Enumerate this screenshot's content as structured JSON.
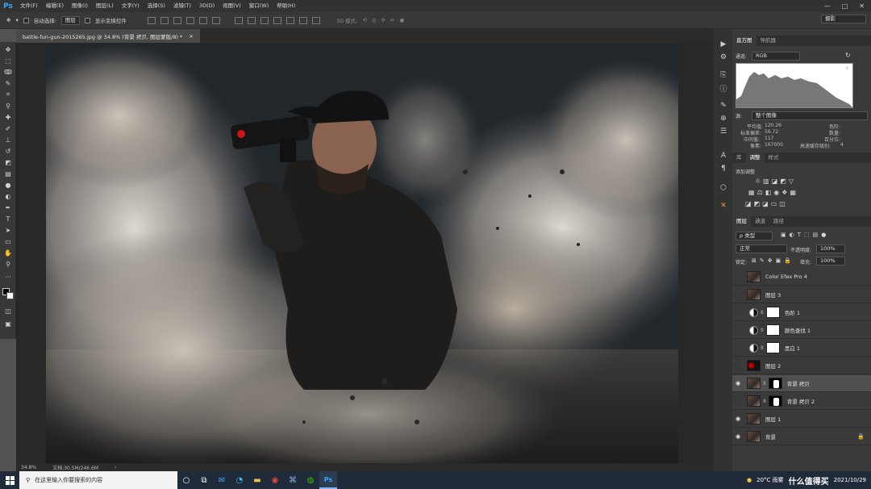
{
  "app": {
    "logo": "Ps",
    "menus": [
      "文件(F)",
      "编辑(E)",
      "图像(I)",
      "图层(L)",
      "文字(Y)",
      "选择(S)",
      "滤镜(T)",
      "3D(D)",
      "视图(V)",
      "窗口(W)",
      "帮助(H)"
    ],
    "window_controls": [
      "—",
      "□",
      "✕"
    ]
  },
  "options": {
    "auto_select_label": "自动选择:",
    "auto_select_value": "图层",
    "show_transform_label": "显示变换控件",
    "mode_3d_label": "3D 模式:",
    "workspace": "摄影"
  },
  "document": {
    "tab_title": "battle-fun-gun-2015265.jpg @ 34.8% (背景 拷贝, 图层蒙版/8) *",
    "close": "×",
    "zoom": "34.8%",
    "doc_info": "文档:30.5M/246.6M",
    "arrow": "›"
  },
  "histogram": {
    "tabs": [
      "直方图",
      "导航器"
    ],
    "channel_label": "通道:",
    "channel_value": "RGB",
    "source_label": "源:",
    "source_value": "整个图像",
    "stats": {
      "mean_label": "平均值:",
      "mean": "120.26",
      "std_label": "标准偏差:",
      "std": "56.72",
      "median_label": "中间值:",
      "median": "117",
      "pixels_label": "像素:",
      "pixels": "167000",
      "level_label": "色阶:",
      "count_label": "数量:",
      "percent_label": "百分位:",
      "cache_label": "高速缓存级别:",
      "cache": "4"
    }
  },
  "adjustments": {
    "tabs": [
      "库",
      "调整",
      "样式"
    ],
    "add_label": "添加调整"
  },
  "layers": {
    "tabs": [
      "图层",
      "通道",
      "路径"
    ],
    "filter_label": "ρ 类型",
    "blend_mode": "正常",
    "opacity_label": "不透明度:",
    "opacity": "100%",
    "lock_label": "锁定:",
    "fill_label": "填充:",
    "fill": "100%",
    "items": [
      {
        "name": "Color Efex Pro 4",
        "visible": false,
        "kind": "photo"
      },
      {
        "name": "图层 3",
        "visible": false,
        "kind": "photo"
      },
      {
        "name": "色阶 1",
        "visible": false,
        "kind": "adj"
      },
      {
        "name": "颜色查找 1",
        "visible": false,
        "kind": "adj"
      },
      {
        "name": "黑白 1",
        "visible": false,
        "kind": "adj"
      },
      {
        "name": "图层 2",
        "visible": false,
        "kind": "red"
      },
      {
        "name": "背景 拷贝",
        "visible": true,
        "kind": "masked",
        "selected": true
      },
      {
        "name": "背景 拷贝 2",
        "visible": false,
        "kind": "masked"
      },
      {
        "name": "图层 1",
        "visible": true,
        "kind": "photo"
      },
      {
        "name": "背景",
        "visible": true,
        "kind": "photo",
        "locked": true
      }
    ]
  },
  "taskbar": {
    "search_placeholder": "在这里输入你要搜索的内容",
    "weather": "20°C 雨雾",
    "date": "2021/10/29",
    "watermark": "什么值得买"
  }
}
